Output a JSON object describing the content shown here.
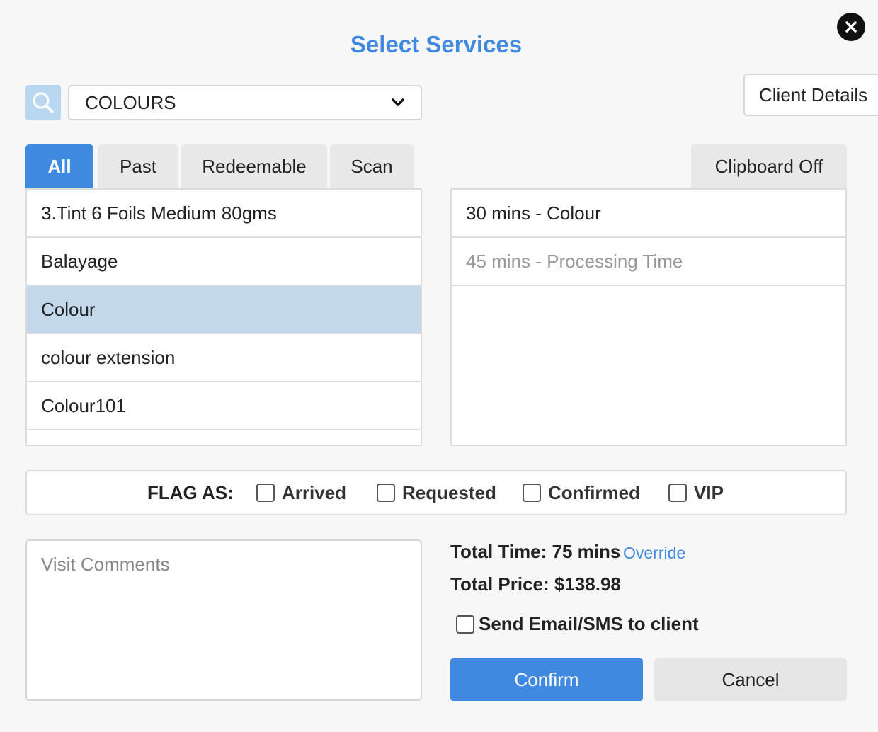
{
  "dialog": {
    "title": "Select Services",
    "close_icon": "close-icon",
    "title_color": "#3f8ae0"
  },
  "search": {
    "icon": "search-icon",
    "category_value": "COLOURS",
    "client_details_label": "Client Details"
  },
  "tabs": [
    {
      "label": "All",
      "active": true
    },
    {
      "label": "Past",
      "active": false
    },
    {
      "label": "Redeemable",
      "active": false
    },
    {
      "label": "Scan",
      "active": false
    }
  ],
  "clipboard_label": "Clipboard Off",
  "services": [
    {
      "label": "3.Tint 6 Foils Medium 80gms",
      "selected": false
    },
    {
      "label": "Balayage",
      "selected": false
    },
    {
      "label": "Colour",
      "selected": true
    },
    {
      "label": "colour extension",
      "selected": false
    },
    {
      "label": "Colour101",
      "selected": false
    }
  ],
  "selected_services": [
    {
      "label": "30 mins - Colour",
      "muted": false
    },
    {
      "label": "45 mins - Processing Time",
      "muted": true
    }
  ],
  "flags": {
    "label": "FLAG AS:",
    "options": [
      {
        "label": "Arrived",
        "checked": false
      },
      {
        "label": "Requested",
        "checked": false
      },
      {
        "label": "Confirmed",
        "checked": false
      },
      {
        "label": "VIP",
        "checked": false
      }
    ]
  },
  "comments": {
    "placeholder": "Visit Comments"
  },
  "summary": {
    "total_time": "Total Time: 75 mins",
    "override_label": "Override",
    "total_price": "Total Price: $138.98",
    "send_label": "Send Email/SMS to client",
    "send_checked": false
  },
  "actions": {
    "confirm_label": "Confirm",
    "cancel_label": "Cancel",
    "accent_color": "#3f8ae0"
  }
}
